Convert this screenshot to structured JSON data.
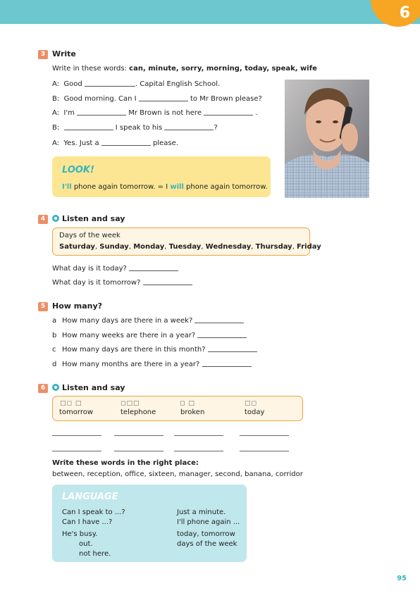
{
  "unit": "6",
  "page_number": "95",
  "ex3": {
    "num": "3",
    "title": "Write",
    "instruction_prefix": "Write in these words: ",
    "instruction_words": "can, minute, sorry, morning, today, speak, wife",
    "dialogue": [
      {
        "speaker": "A:",
        "parts": [
          "Good",
          ". Capital English School."
        ]
      },
      {
        "speaker": "B:",
        "parts": [
          "Good morning. Can I",
          "to Mr Brown please?"
        ]
      },
      {
        "speaker": "A:",
        "parts": [
          "I'm",
          "Mr Brown is not here",
          "."
        ]
      },
      {
        "speaker": "B:",
        "parts": [
          "",
          "I speak to his",
          "?"
        ]
      },
      {
        "speaker": "A:",
        "parts": [
          "Yes. Just a",
          "please."
        ]
      }
    ]
  },
  "look": {
    "title": "LOOK!",
    "contraction": "I'll",
    "text1": " phone again tomorrow. = I ",
    "will": "will",
    "text2": " phone again tomorrow."
  },
  "ex4": {
    "num": "4",
    "title": "Listen and say",
    "box_caption": "Days of the week",
    "days": [
      "Saturday",
      "Sunday",
      "Monday",
      "Tuesday",
      "Wednesday",
      "Thursday",
      "Friday"
    ],
    "questions": [
      "What day is it today?",
      "What day is it tomorrow?"
    ]
  },
  "ex5": {
    "num": "5",
    "title": "How many?",
    "items": [
      {
        "letter": "a",
        "text": "How many days are there in a week?"
      },
      {
        "letter": "b",
        "text": "How many weeks are there in a year?"
      },
      {
        "letter": "c",
        "text": "How many days are there in this month?"
      },
      {
        "letter": "d",
        "text": "How many months are there in a year?"
      }
    ]
  },
  "ex6": {
    "num": "6",
    "title": "Listen and say",
    "words": [
      "tomorrow",
      "telephone",
      "broken",
      "today"
    ],
    "stress_marks": [
      "□◻ □",
      "◻□□",
      "◻ □",
      "□◻"
    ],
    "instruction": "Write these words in the right place:",
    "word_list": "between, reception, office, sixteen, manager, second, banana, corridor"
  },
  "language": {
    "title": "LANGUAGE",
    "left": [
      "Can I speak to ...?",
      "Can I have ...?",
      "He's busy.",
      "out.",
      "not here."
    ],
    "right": [
      "Just a minute.",
      "I'll phone again ...",
      "today, tomorrow",
      "days of the week"
    ]
  }
}
